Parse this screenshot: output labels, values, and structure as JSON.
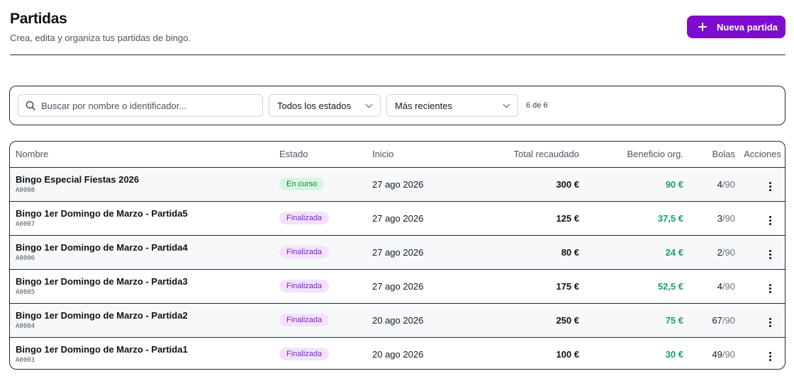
{
  "header": {
    "title": "Partidas",
    "subtitle": "Crea, edita y organiza tus partidas de bingo.",
    "new_button_label": "Nueva partida",
    "new_button_icon": "plus-icon"
  },
  "filters": {
    "search_placeholder": "Buscar por nombre o identificador...",
    "search_icon": "search-icon",
    "status_selected": "Todos los estados",
    "order_selected": "Más recientes",
    "count_text": "6 de 6"
  },
  "table": {
    "columns": [
      "Nombre",
      "Estado",
      "Inicio",
      "Total recaudado",
      "Beneficio org.",
      "Bolas",
      "Acciones"
    ],
    "rows": [
      {
        "name": "Bingo Especial Fiestas 2026",
        "id": "A0008",
        "status": "En curso",
        "status_type": "running",
        "start": "27 ago 2026",
        "total": "300 €",
        "profit": "90 €",
        "balls_drawn": "4",
        "balls_total": "/90"
      },
      {
        "name": "Bingo 1er Domingo de Marzo - Partida5",
        "id": "A0007",
        "status": "Finalizada",
        "status_type": "finished",
        "start": "27 ago 2026",
        "total": "125 €",
        "profit": "37,5 €",
        "balls_drawn": "3",
        "balls_total": "/90"
      },
      {
        "name": "Bingo 1er Domingo de Marzo - Partida4",
        "id": "A0006",
        "status": "Finalizada",
        "status_type": "finished",
        "start": "27 ago 2026",
        "total": "80 €",
        "profit": "24 €",
        "balls_drawn": "2",
        "balls_total": "/90"
      },
      {
        "name": "Bingo 1er Domingo de Marzo - Partida3",
        "id": "A0005",
        "status": "Finalizada",
        "status_type": "finished",
        "start": "27 ago 2026",
        "total": "175 €",
        "profit": "52,5 €",
        "balls_drawn": "4",
        "balls_total": "/90"
      },
      {
        "name": "Bingo 1er Domingo de Marzo - Partida2",
        "id": "A0004",
        "status": "Finalizada",
        "status_type": "finished",
        "start": "20 ago 2026",
        "total": "250 €",
        "profit": "75 €",
        "balls_drawn": "67",
        "balls_total": "/90"
      },
      {
        "name": "Bingo 1er Domingo de Marzo - Partida1",
        "id": "A0003",
        "status": "Finalizada",
        "status_type": "finished",
        "start": "20 ago 2026",
        "total": "100 €",
        "profit": "30 €",
        "balls_drawn": "49",
        "balls_total": "/90"
      }
    ]
  },
  "colors": {
    "accent": "#7e0ccf",
    "profit_green": "#16a063",
    "running_badge_bg": "#d7f5e0",
    "finished_badge_bg": "#f2e3fb"
  }
}
